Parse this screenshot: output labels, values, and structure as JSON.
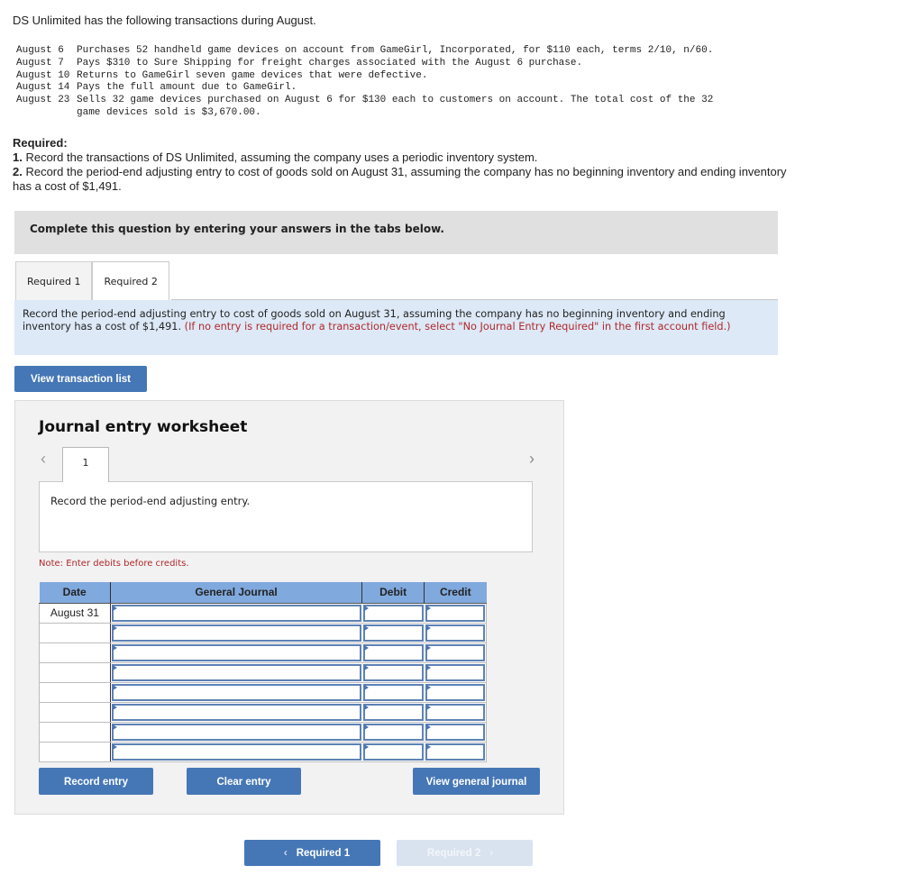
{
  "intro": "DS Unlimited has the following transactions during August.",
  "transactions": [
    {
      "date": "August 6",
      "desc": "Purchases 52 handheld game devices on account from GameGirl, Incorporated, for $110 each, terms 2/10, n/60."
    },
    {
      "date": "August 7",
      "desc": "Pays $310 to Sure Shipping for freight charges associated with the August 6 purchase."
    },
    {
      "date": "August 10",
      "desc": "Returns to GameGirl seven game devices that were defective."
    },
    {
      "date": "August 14",
      "desc": "Pays the full amount due to GameGirl."
    },
    {
      "date": "August 23",
      "desc": "Sells 32 game devices purchased on August 6 for $130 each to customers on account. The total cost of the 32\ngame devices sold is $3,670.00."
    }
  ],
  "required": {
    "heading": "Required:",
    "items": [
      {
        "num": "1.",
        "text": " Record the transactions of DS Unlimited, assuming the company uses a periodic inventory system."
      },
      {
        "num": "2.",
        "text": " Record the period-end adjusting entry to cost of goods sold on August 31, assuming the company has no beginning inventory and ending inventory has a cost of $1,491."
      }
    ]
  },
  "complete_bar": "Complete this question by entering your answers in the tabs below.",
  "tabs": [
    {
      "label": "Required 1",
      "active": false
    },
    {
      "label": "Required 2",
      "active": true
    }
  ],
  "instruction": {
    "main": "Record the period-end adjusting entry to cost of goods sold on August 31, assuming the company has no beginning inventory and ending inventory has a cost of $1,491. ",
    "note": "(If no entry is required for a transaction/event, select \"No Journal Entry Required\" in the first account field.)"
  },
  "view_transaction_list": "View transaction list",
  "worksheet": {
    "title": "Journal entry worksheet",
    "prev_icon": "‹",
    "next_icon": "›",
    "entry_tab": "1",
    "panel_text": "Record the period-end adjusting entry.",
    "note": "Note: Enter debits before credits.",
    "columns": [
      "Date",
      "General Journal",
      "Debit",
      "Credit"
    ],
    "rows": [
      {
        "date": "August 31",
        "account": "",
        "debit": "",
        "credit": ""
      },
      {
        "date": "",
        "account": "",
        "debit": "",
        "credit": ""
      },
      {
        "date": "",
        "account": "",
        "debit": "",
        "credit": ""
      },
      {
        "date": "",
        "account": "",
        "debit": "",
        "credit": ""
      },
      {
        "date": "",
        "account": "",
        "debit": "",
        "credit": ""
      },
      {
        "date": "",
        "account": "",
        "debit": "",
        "credit": ""
      },
      {
        "date": "",
        "account": "",
        "debit": "",
        "credit": ""
      },
      {
        "date": "",
        "account": "",
        "debit": "",
        "credit": ""
      }
    ],
    "buttons": {
      "record": "Record entry",
      "clear": "Clear entry",
      "view_gj": "View general journal"
    }
  },
  "nav": {
    "prev_label": "Required 1",
    "next_label": "Required 2",
    "prev_icon": "‹",
    "next_icon": "›"
  },
  "colors": {
    "button_blue": "#4577b6",
    "header_blue": "#80a9de",
    "instruction_bg": "#dde9f7",
    "note_red": "#b0282a",
    "disabled_button": "#d9e3ef"
  }
}
